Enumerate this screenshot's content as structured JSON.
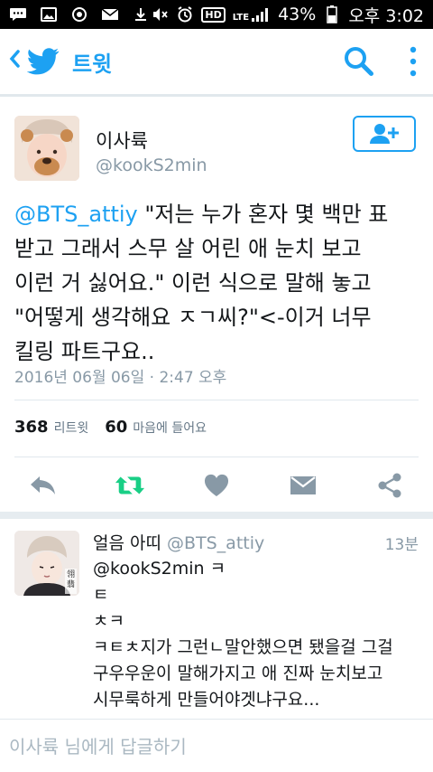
{
  "status_bar": {
    "icons_left": [
      "message-icon",
      "gallery-icon",
      "sync-icon",
      "mail-icon",
      "download-icon"
    ],
    "icons_right": [
      "mute-icon",
      "alarm-icon",
      "hd-icon",
      "lte-signal-icon",
      "battery-icon"
    ],
    "hd_label": "HD",
    "lte_label": "LTE",
    "battery": "43%",
    "time": "오후 3:02"
  },
  "app_bar": {
    "title": "트윗",
    "accent_color": "#1da1f2"
  },
  "tweet": {
    "author_name": "이사륙",
    "author_handle": "@kookS2min",
    "text_mention": "@BTS_attiy",
    "text_lines": [
      " \"저는 누가 혼자 몇 백만 표",
      "받고 그래서 스무 살 어린 애 눈치 보고",
      "이런 거 싫어요.\" 이런 식으로 말해 놓고",
      "\"어떻게 생각해요 ㅈㄱ씨?\"<-이거 너무",
      "킬링 파트구요.."
    ],
    "timestamp": "2016년 06월 06일 · 2:47 오후",
    "retweet_count": "368",
    "retweet_label": "리트윗",
    "like_count": "60",
    "like_label": "마음에 들어요"
  },
  "reply": {
    "name": "얼음 아띠",
    "handle": "@BTS_attiy",
    "time": "13분",
    "lines": [
      "@kookS2min ㅋ",
      "ㅌ",
      "ㅊㅋ",
      "ㅋㅌㅊ지가 그런ㄴ말안했으면 됐을걸 그걸",
      "구우우운이 말해가지고 애 진짜 눈치보고",
      "시무룩하게 만들어야겟냐구요..."
    ],
    "avatar_text": "翎翡"
  },
  "reply_input": {
    "placeholder": "이사륙 님에게 답글하기"
  }
}
